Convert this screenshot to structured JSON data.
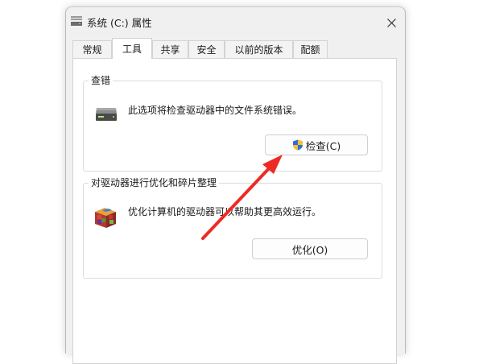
{
  "window": {
    "title": "系统 (C:) 属性",
    "close_icon": "close-icon"
  },
  "tabs": [
    {
      "label": "常规"
    },
    {
      "label": "工具",
      "active": true
    },
    {
      "label": "共享"
    },
    {
      "label": "安全"
    },
    {
      "label": "以前的版本"
    },
    {
      "label": "配额"
    }
  ],
  "error_checking": {
    "heading": "查错",
    "description": "此选项将检查驱动器中的文件系统错误。",
    "icon": "drive-icon",
    "button_label": "检查(C)",
    "button_icon": "uac-shield-icon"
  },
  "optimize": {
    "heading": "对驱动器进行优化和碎片整理",
    "description": "优化计算机的驱动器可以帮助其更高效运行。",
    "icon": "defrag-icon",
    "button_label": "优化(O)"
  },
  "annotation": {
    "arrow_color": "#ee2a24"
  }
}
